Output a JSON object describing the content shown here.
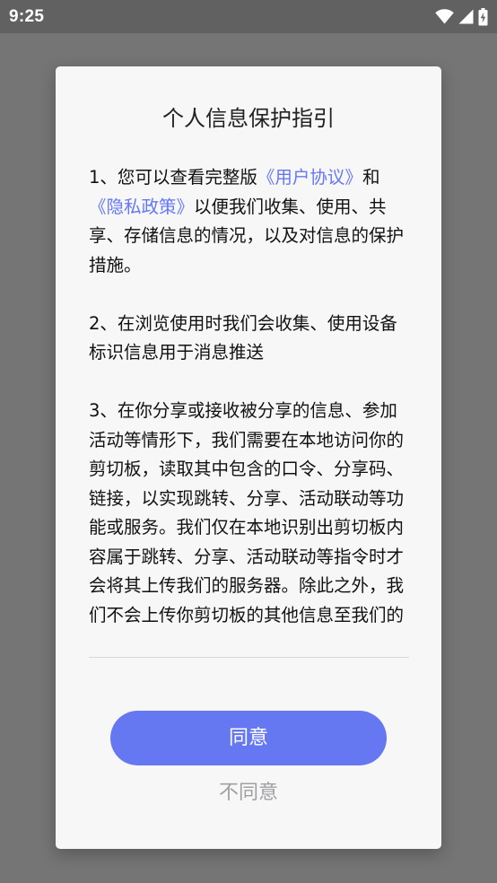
{
  "status_bar": {
    "time": "9:25",
    "icons": [
      "wifi-icon",
      "cellular-signal-icon",
      "battery-charging-icon"
    ],
    "color": "#ffffff"
  },
  "dialog": {
    "title": "个人信息保护指引",
    "paragraph1": {
      "prefix": "1、您可以查看完整版",
      "user_agreement_link": "《用户协议》",
      "middle": "和",
      "privacy_policy_link": "《隐私政策》",
      "suffix": "以便我们收集、使用、共享、存储信息的情况，以及对信息的保护措施。"
    },
    "paragraph2": "2、在浏览使用时我们会收集、使用设备标识信息用于消息推送",
    "paragraph3": "3、在你分享或接收被分享的信息、参加活动等情形下，我们需要在本地访问你的剪切板，读取其中包含的口令、分享码、链接，以实现跳转、分享、活动联动等功能或服务。我们仅在本地识别出剪切板内容属于跳转、分享、活动联动等指令时才会将其上传我们的服务器。除此之外，我们不会上传你剪切板的其他信息至我们的",
    "agree_label": "同意",
    "disagree_label": "不同意"
  },
  "colors": {
    "accent": "#6677f2",
    "scrim": "#757575",
    "dialog_background": "#f7f7f8",
    "secondary_text": "#a0a0a3"
  }
}
